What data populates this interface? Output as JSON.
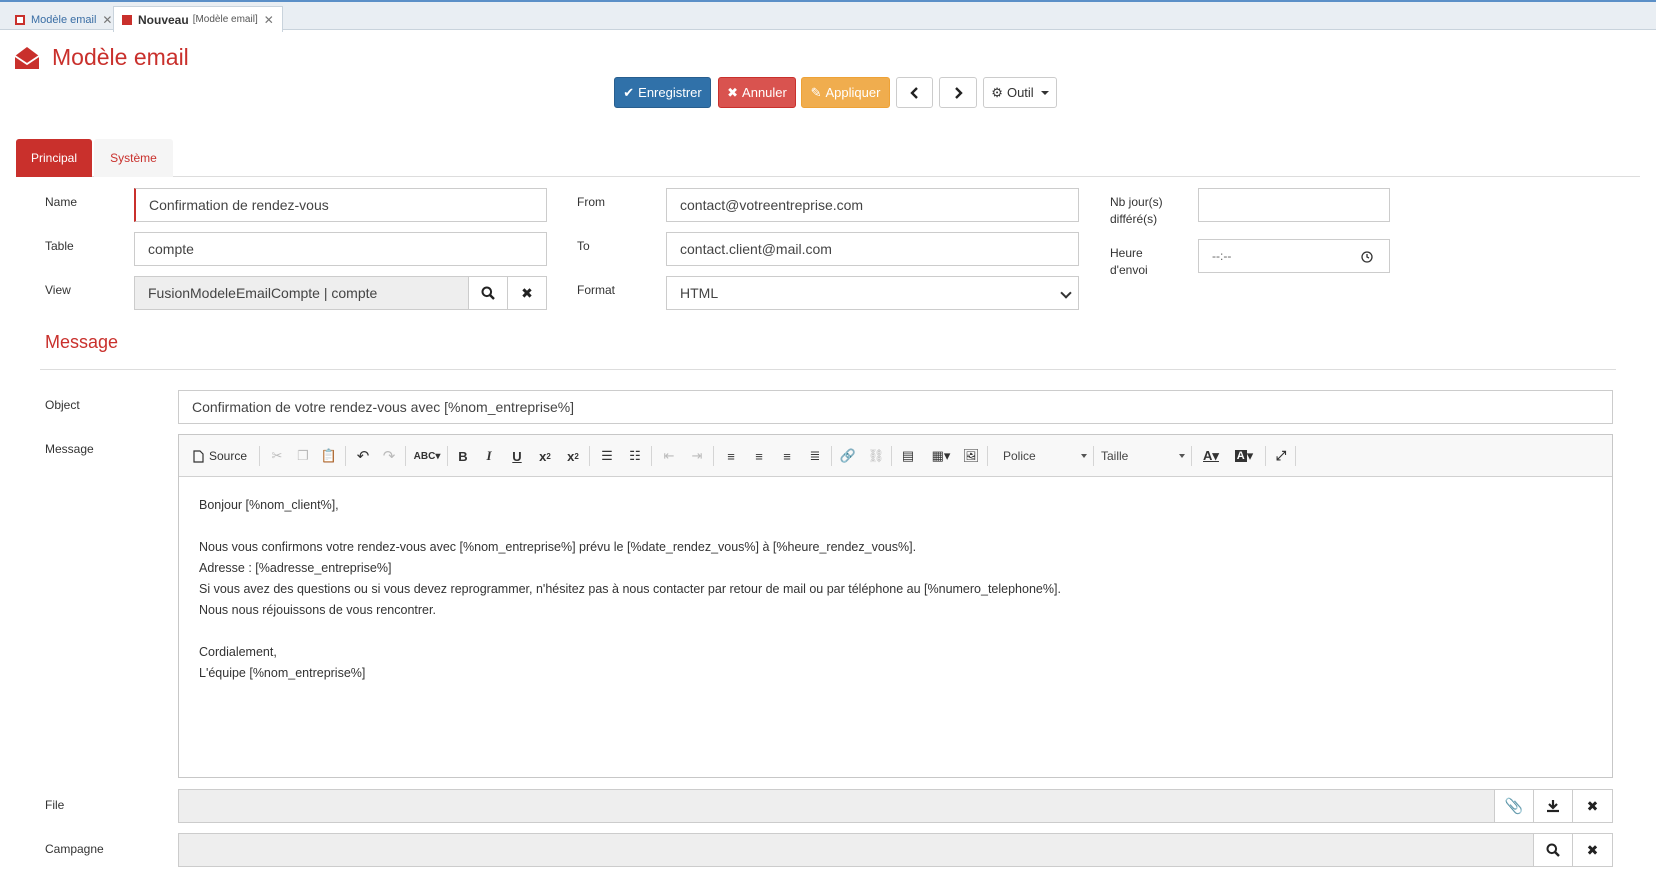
{
  "window_tabs": [
    {
      "title": "Modèle email",
      "subtitle": ""
    },
    {
      "title": "Nouveau",
      "subtitle": "[Modèle email]"
    }
  ],
  "page": {
    "title": "Modèle email"
  },
  "toolbar": {
    "save_label": "Enregistrer",
    "cancel_label": "Annuler",
    "apply_label": "Appliquer",
    "tool_label": "Outil"
  },
  "section_tabs": [
    "Principal",
    "Système"
  ],
  "form": {
    "name_label": "Name",
    "name_value": "Confirmation de rendez-vous",
    "table_label": "Table",
    "table_value": "compte",
    "view_label": "View",
    "view_value": "FusionModeleEmailCompte | compte",
    "from_label": "From",
    "from_value": "contact@votreentreprise.com",
    "to_label": "To",
    "to_value": "contact.client@mail.com",
    "format_label": "Format",
    "format_value": "HTML",
    "delay_label_line1": "Nb jour(s)",
    "delay_label_line2": "différé(s)",
    "delay_value": "",
    "time_label_line1": "Heure",
    "time_label_line2": "d'envoi",
    "time_value": "--:--"
  },
  "message_section": {
    "title": "Message",
    "object_label": "Object",
    "object_value": "Confirmation de votre rendez-vous avec [%nom_entreprise%]",
    "message_label": "Message",
    "editor": {
      "source_label": "Source",
      "font_label": "Police",
      "size_label": "Taille",
      "body_lines": [
        "Bonjour [%nom_client%],",
        "",
        "Nous vous confirmons votre rendez-vous avec [%nom_entreprise%] prévu le [%date_rendez_vous%] à [%heure_rendez_vous%].",
        "Adresse : [%adresse_entreprise%]",
        "Si vous avez des questions ou si vous devez reprogrammer, n'hésitez pas à nous contacter par retour de mail ou par téléphone au [%numero_telephone%].",
        "Nous nous réjouissons de vous rencontrer.",
        "",
        "Cordialement,",
        "L'équipe [%nom_entreprise%]"
      ]
    },
    "file_label": "File",
    "file_value": "",
    "campaign_label": "Campagne",
    "campaign_value": ""
  },
  "colors": {
    "accent": "#c9302c",
    "primary": "#3071a9",
    "warning": "#f0ad4e"
  }
}
